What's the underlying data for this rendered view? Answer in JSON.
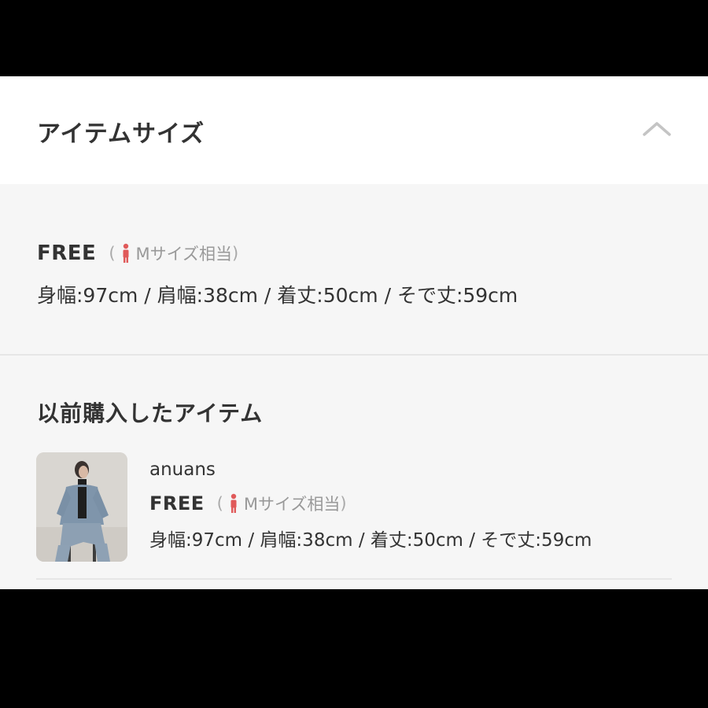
{
  "header": {
    "title": "アイテムサイズ"
  },
  "current_size": {
    "size_label": "FREE",
    "paren_open": "(",
    "equivalent_label": "Mサイズ相当",
    "paren_close": ")",
    "measurements": "身幅:97cm / 肩幅:38cm / 着丈:50cm / そで丈:59cm"
  },
  "previous": {
    "title": "以前購入したアイテム",
    "items": [
      {
        "brand": "anuans",
        "size_label": "FREE",
        "paren_open": "(",
        "equivalent_label": "Mサイズ相当",
        "paren_close": ")",
        "measurements": "身幅:97cm / 肩幅:38cm / 着丈:50cm / そで丈:59cm"
      }
    ]
  },
  "colors": {
    "text": "#333333",
    "muted": "#999999",
    "person_icon": "#e05a5a",
    "panel": "#f6f6f6"
  },
  "icons": {
    "collapse": "chevron-up-icon",
    "person": "person-icon"
  }
}
